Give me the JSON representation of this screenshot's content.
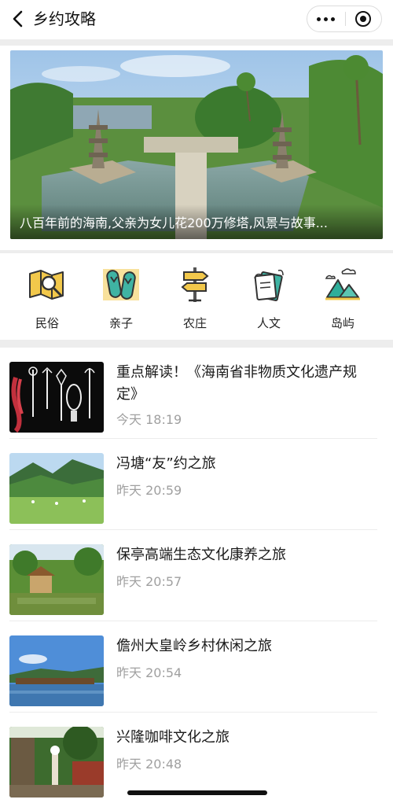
{
  "nav": {
    "title": "乡约攻略"
  },
  "banner": {
    "caption": "八百年前的海南,父亲为女儿花200万修塔,风景与故事..."
  },
  "categories": [
    {
      "label": "民俗",
      "icon": "map-magnifier-icon"
    },
    {
      "label": "亲子",
      "icon": "flip-flops-icon"
    },
    {
      "label": "农庄",
      "icon": "signpost-icon"
    },
    {
      "label": "人文",
      "icon": "book-icon"
    },
    {
      "label": "岛屿",
      "icon": "island-mountains-icon"
    }
  ],
  "articles": [
    {
      "title": "重点解读！《海南省非物质文化遗产规定》",
      "time": "今天 18:19"
    },
    {
      "title": "冯塘“友”约之旅",
      "time": "昨天 20:59"
    },
    {
      "title": "保亭高端生态文化康养之旅",
      "time": "昨天 20:57"
    },
    {
      "title": "儋州大皇岭乡村休闲之旅",
      "time": "昨天 20:54"
    },
    {
      "title": "兴隆咖啡文化之旅",
      "time": "昨天 20:48"
    }
  ],
  "colors": {
    "accent_yellow": "#f2c84b",
    "accent_teal": "#2fae9a",
    "icon_stroke": "#333333"
  }
}
